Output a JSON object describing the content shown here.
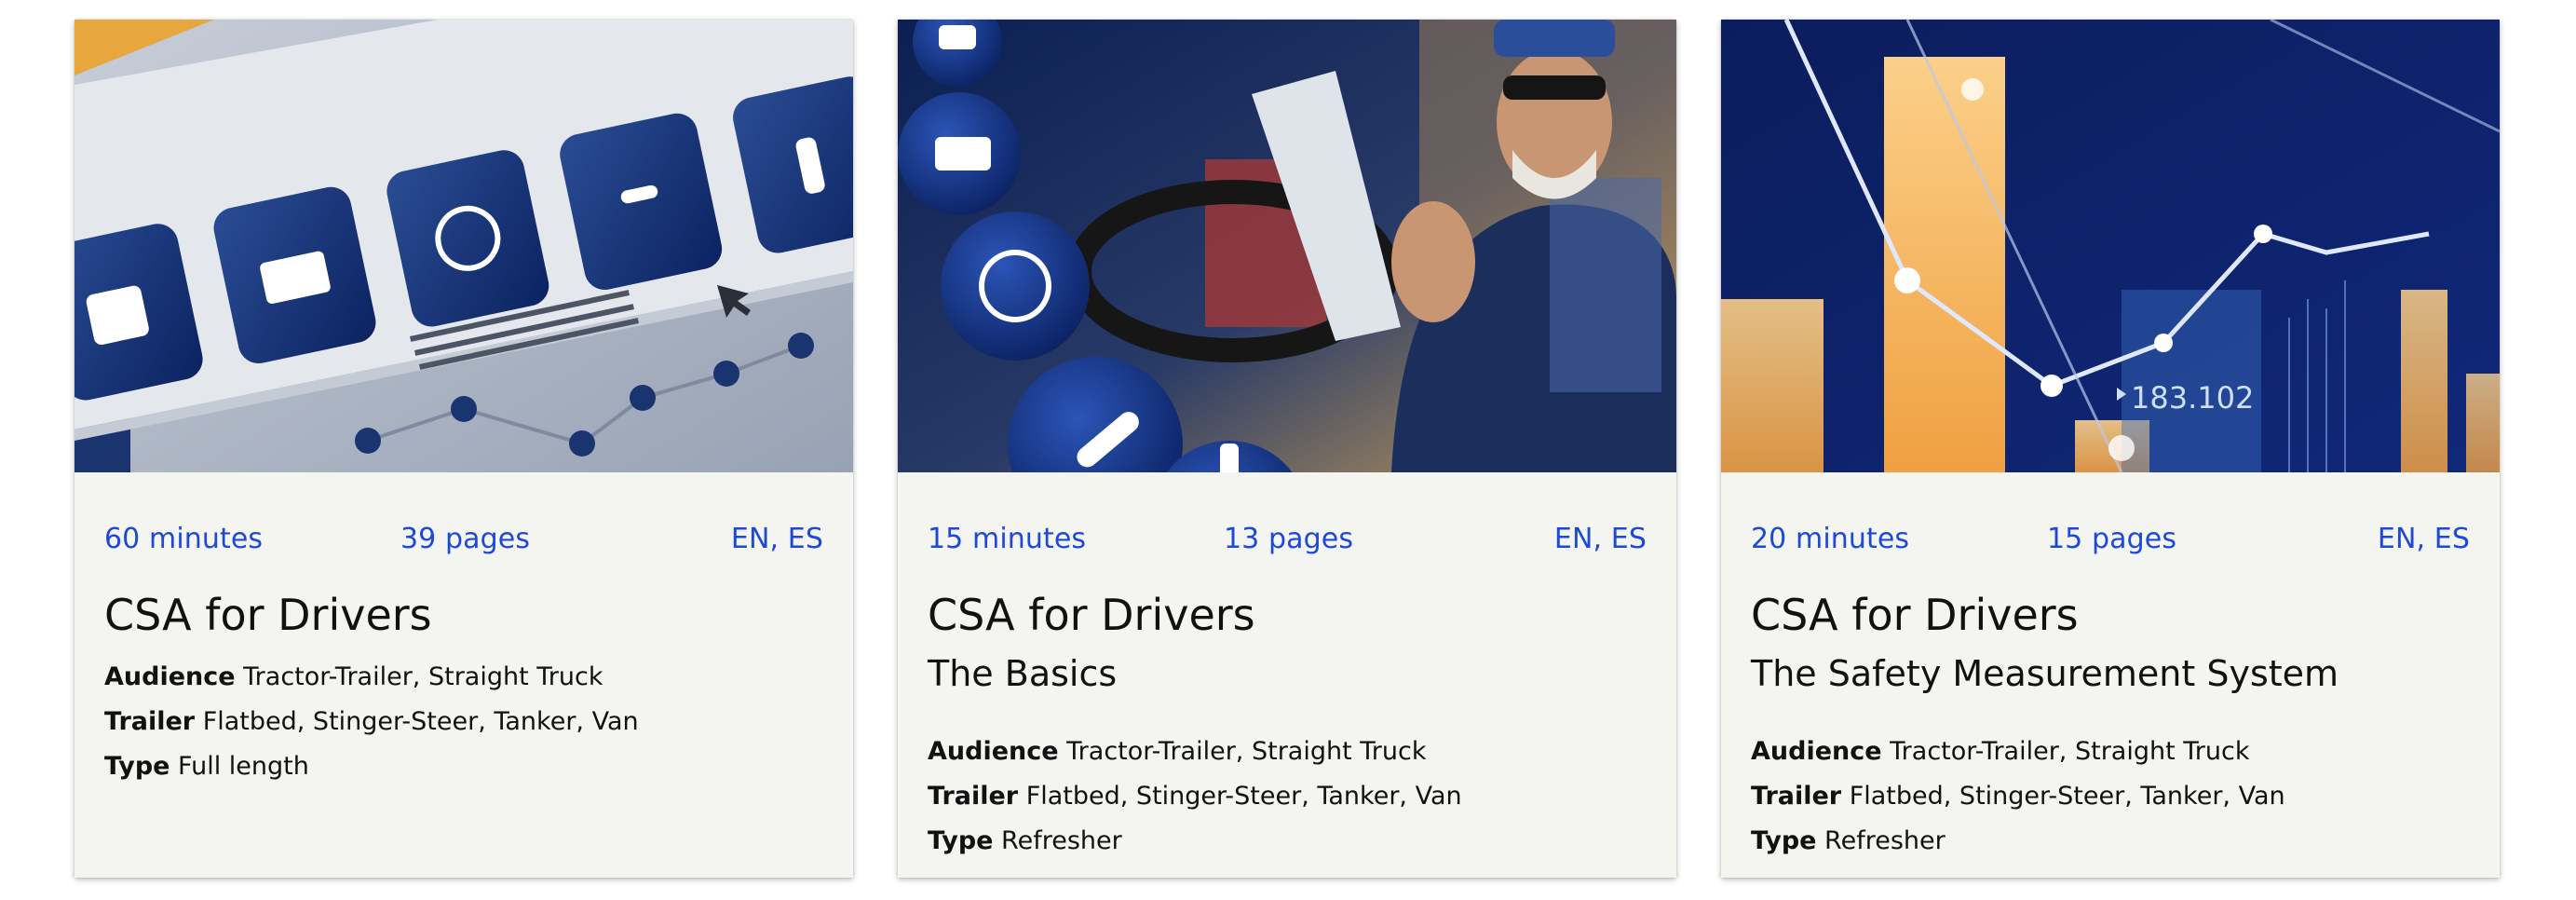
{
  "cards": [
    {
      "image": "dashboard-icons-illustration",
      "duration": "60 minutes",
      "pages": "39 pages",
      "languages": "EN, ES",
      "title": "CSA for Drivers",
      "subtitle": "",
      "audience_label": "Audience",
      "audience": "Tractor-Trailer, Straight Truck",
      "trailer_label": "Trailer",
      "trailer": "Flatbed, Stinger-Steer, Tanker, Van",
      "type_label": "Type",
      "type": "Full length"
    },
    {
      "image": "smiling-truck-driver-photo",
      "duration": "15 minutes",
      "pages": "13 pages",
      "languages": "EN, ES",
      "title": "CSA for Drivers",
      "subtitle": "The Basics",
      "audience_label": "Audience",
      "audience": "Tractor-Trailer, Straight Truck",
      "trailer_label": "Trailer",
      "trailer": "Flatbed, Stinger-Steer, Tanker, Van",
      "type_label": "Type",
      "type": "Refresher"
    },
    {
      "image": "data-chart-graphic",
      "duration": "20 minutes",
      "pages": "15 pages",
      "languages": "EN, ES",
      "title": "CSA for Drivers",
      "subtitle": "The Safety Measurement System",
      "chart_figure": "183.102",
      "audience_label": "Audience",
      "audience": "Tractor-Trailer, Straight Truck",
      "trailer_label": "Trailer",
      "trailer": "Flatbed, Stinger-Steer, Tanker, Van",
      "type_label": "Type",
      "type": "Refresher"
    }
  ],
  "colors": {
    "accent_blue": "#1c49d6",
    "navy": "#0f2c6e",
    "card_bg": "#f4f4f1",
    "orange": "#f2a54a"
  }
}
